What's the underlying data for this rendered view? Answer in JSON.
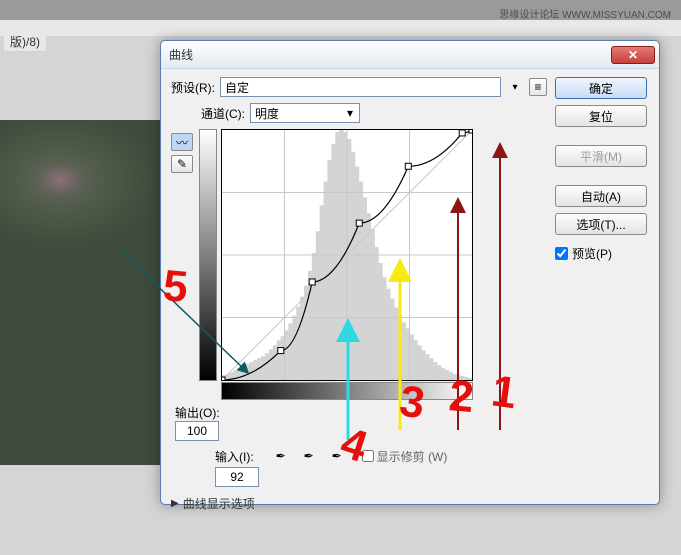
{
  "watermark": "思缘设计论坛 WWW.MISSYUAN.COM",
  "doc_tab": "版)/8)",
  "dialog": {
    "title": "曲线",
    "close_symbol": "✕"
  },
  "preset": {
    "label": "预设(R):",
    "value": "自定"
  },
  "channel": {
    "label": "通道(C):",
    "value": "明度"
  },
  "output": {
    "label": "输出(O):",
    "value": "100"
  },
  "input": {
    "label": "输入(I):",
    "value": "92"
  },
  "show_clip": "显示修剪 (W)",
  "disclosure": "曲线显示选项",
  "buttons": {
    "ok": "确定",
    "cancel": "复位",
    "smooth": "平滑(M)",
    "auto": "自动(A)",
    "options": "选项(T)..."
  },
  "preview_label": "预览(P)",
  "preview_checked": true,
  "icons": {
    "menu": "≡",
    "curve_tool": "〰",
    "pencil_tool": "✎",
    "tri": "▶",
    "dropper": "✒"
  },
  "chart_data": {
    "type": "curve",
    "title": "",
    "xlabel": "输入",
    "ylabel": "输出",
    "xlim": [
      0,
      255
    ],
    "ylim": [
      0,
      255
    ],
    "points": [
      {
        "x": 0,
        "y": 0
      },
      {
        "x": 60,
        "y": 30
      },
      {
        "x": 92,
        "y": 100
      },
      {
        "x": 140,
        "y": 160
      },
      {
        "x": 190,
        "y": 218
      },
      {
        "x": 245,
        "y": 252
      },
      {
        "x": 255,
        "y": 255
      }
    ],
    "histogram": [
      5,
      6,
      8,
      10,
      12,
      14,
      16,
      18,
      20,
      22,
      24,
      27,
      31,
      35,
      40,
      44,
      50,
      57,
      65,
      74,
      84,
      95,
      110,
      128,
      150,
      176,
      200,
      222,
      238,
      250,
      252,
      250,
      243,
      230,
      215,
      200,
      184,
      168,
      152,
      134,
      118,
      104,
      92,
      82,
      73,
      65,
      58,
      52,
      46,
      40,
      35,
      30,
      26,
      22,
      18,
      15,
      12,
      10,
      8,
      6,
      5,
      4,
      3,
      2
    ],
    "annotations": [
      "1",
      "2",
      "3",
      "4",
      "5"
    ]
  }
}
